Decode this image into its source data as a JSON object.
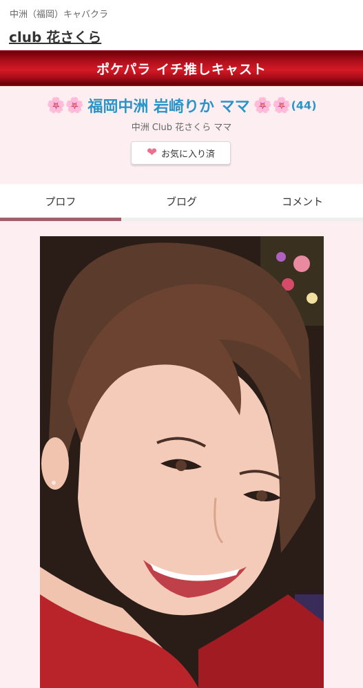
{
  "header": {
    "area": "中洲（福岡）キャバクラ",
    "shop_name": "club 花さくら"
  },
  "banner": {
    "text": "ポケパラ イチ推しキャスト"
  },
  "profile": {
    "flowers_left": "🌸🌸",
    "name": "福岡中洲 岩崎りか ママ",
    "flowers_right": "🌸🌸",
    "age": "(44)",
    "subtitle": "中洲 Club 花さくら ママ",
    "favorite_label": "お気に入り済"
  },
  "tabs": [
    {
      "label": "プロフ",
      "active": true
    },
    {
      "label": "ブログ",
      "active": false
    },
    {
      "label": "コメント",
      "active": false
    }
  ],
  "colors": {
    "banner_red": "#c8141f",
    "cast_name_blue": "#2a94c8",
    "pink_bg": "#fdeff1",
    "heart_pink": "#f06e8c",
    "tab_active_line": "#a0606a"
  }
}
